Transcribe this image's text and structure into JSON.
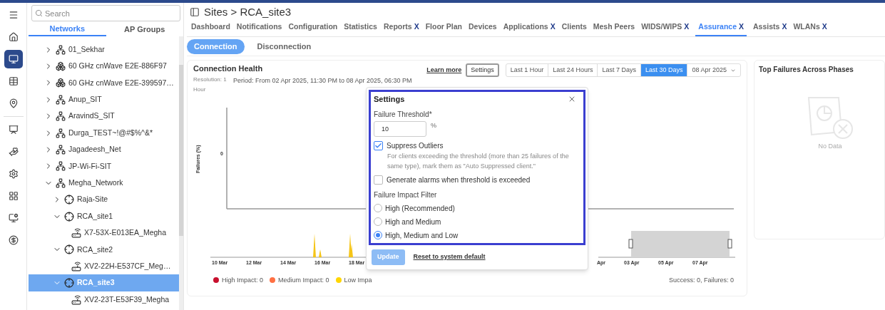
{
  "rail": [
    {
      "selected": false
    },
    {
      "selected": false
    },
    {
      "selected": true
    },
    {
      "selected": false
    },
    {
      "selected": false
    },
    {
      "selected": false
    },
    {
      "selected": false
    },
    {
      "selected": false
    },
    {
      "selected": false
    },
    {
      "selected": false
    },
    {
      "selected": false
    }
  ],
  "sidebar": {
    "search_placeholder": "Search",
    "tabs": [
      {
        "label": "Networks",
        "selected": true
      },
      {
        "label": "AP Groups",
        "selected": false
      }
    ],
    "tree": [
      {
        "label": "01_Sekhar",
        "kind": "network",
        "expanded": false,
        "selected": false
      },
      {
        "label": "60 GHz cnWave E2E-886F97",
        "kind": "cnwave",
        "expanded": false,
        "selected": false
      },
      {
        "label": "60 GHz cnWave E2E-399597…",
        "kind": "cnwave",
        "expanded": false,
        "selected": false
      },
      {
        "label": "Anup_SIT",
        "kind": "network",
        "expanded": false,
        "selected": false
      },
      {
        "label": "AravindS_SIT",
        "kind": "network",
        "expanded": false,
        "selected": false
      },
      {
        "label": "Durga_TEST~!@#$%^&*",
        "kind": "network",
        "expanded": false,
        "selected": false
      },
      {
        "label": "Jagadeesh_Net",
        "kind": "network",
        "expanded": false,
        "selected": false
      },
      {
        "label": "JP-Wi-Fi-SIT",
        "kind": "network",
        "expanded": false,
        "selected": false
      },
      {
        "label": "Megha_Network",
        "kind": "network",
        "expanded": true,
        "selected": false,
        "children": [
          {
            "label": "Raja-Site",
            "kind": "site",
            "expanded": false,
            "selected": false
          },
          {
            "label": "RCA_site1",
            "kind": "site",
            "expanded": true,
            "selected": false,
            "children": [
              {
                "label": "X7-53X-E013EA_Megha",
                "kind": "ap",
                "selected": false
              }
            ]
          },
          {
            "label": "RCA_site2",
            "kind": "site",
            "expanded": true,
            "selected": false,
            "children": [
              {
                "label": "XV2-22H-E537CF_Meg…",
                "kind": "ap",
                "selected": false
              }
            ]
          },
          {
            "label": "RCA_site3",
            "kind": "site",
            "expanded": true,
            "selected": true,
            "children": [
              {
                "label": "XV2-23T-E53F39_Megha",
                "kind": "ap",
                "selected": false
              }
            ]
          }
        ]
      }
    ]
  },
  "breadcrumb": "Sites > RCA_site3",
  "tabs": [
    {
      "label": "Dashboard",
      "selected": false
    },
    {
      "label": "Notifications",
      "selected": false
    },
    {
      "label": "Configuration",
      "selected": false
    },
    {
      "label": "Statistics",
      "selected": false
    },
    {
      "label": "Reports",
      "close": "X",
      "selected": false
    },
    {
      "label": "Floor Plan",
      "selected": false
    },
    {
      "label": "Devices",
      "selected": false
    },
    {
      "label": "Applications",
      "close": "X",
      "selected": false
    },
    {
      "label": "Clients",
      "selected": false
    },
    {
      "label": "Mesh Peers",
      "selected": false
    },
    {
      "label": "WIDS/WIPS",
      "close": "X",
      "selected": false
    },
    {
      "label": "Assurance",
      "close": "X",
      "selected": true
    },
    {
      "label": "Assists",
      "close": "X",
      "selected": false
    },
    {
      "label": "WLANs",
      "close": "X",
      "selected": false
    }
  ],
  "subtabs": [
    {
      "label": "Connection",
      "selected": true
    },
    {
      "label": "Disconnection",
      "selected": false
    }
  ],
  "health": {
    "title": "Connection Health",
    "resolution": "Resolution: 1 Hour",
    "period": "Period: From 02 Apr 2025, 11:30 PM to 08 Apr 2025, 06:30 PM",
    "learn_more": "Learn more",
    "settings_button": "Settings",
    "ranges": [
      {
        "label": "Last 1 Hour",
        "selected": false
      },
      {
        "label": "Last 24 Hours",
        "selected": false
      },
      {
        "label": "Last 7 Days",
        "selected": false
      },
      {
        "label": "Last 30 Days",
        "selected": true
      }
    ],
    "date": "08 Apr 2025",
    "ylabel": "Failures (%)",
    "ytick": "0",
    "x_ticks_left": [
      "10 Mar",
      "12 Mar",
      "14 Mar",
      "16 Mar",
      "18 Mar"
    ],
    "x_ticks_right": [
      "Apr",
      "03 Apr",
      "05 Apr",
      "07 Apr"
    ],
    "legend": [
      {
        "label": "High Impact: 0",
        "color": "#c8102e"
      },
      {
        "label": "Medium Impact: 0",
        "color": "#ff7043"
      },
      {
        "label": "Low Impa",
        "color": "#ffd600"
      }
    ],
    "summary": "Success: 0, Failures: 0"
  },
  "settings_popover": {
    "title": "Settings",
    "threshold_label": "Failure Threshold*",
    "threshold_value": "10",
    "unit": "%",
    "checkboxes": [
      {
        "label": "Suppress Outliers",
        "checked": true,
        "description": "For clients exceeding the threshold (more than 25 failures of the same type), mark them as \"Auto Suppressed client.\""
      },
      {
        "label": "Generate alarms when threshold is exceeded",
        "checked": false
      }
    ],
    "filter_label": "Failure Impact Filter",
    "options": [
      {
        "label": "High (Recommended)",
        "selected": false
      },
      {
        "label": "High and Medium",
        "selected": false
      },
      {
        "label": "High, Medium and Low",
        "selected": true
      }
    ],
    "update": {
      "label": "Update",
      "disabled": true
    },
    "reset": "Reset to system default"
  },
  "top_failures": {
    "title": "Top Failures Across Phases",
    "empty": "No Data"
  }
}
